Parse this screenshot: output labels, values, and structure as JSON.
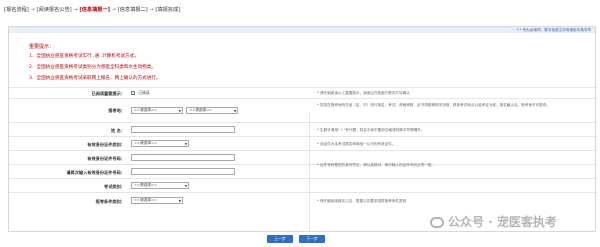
{
  "steps": {
    "s1": "[报名流程]",
    "s2": "[阅读报名公告]",
    "s3": "[信息填报一]",
    "s4": "[信息填报二]",
    "s5": "[填报完成]",
    "arrow": "→"
  },
  "header": {
    "required_tip": "* * 号为必填项，数字及英文字母请用半角字符"
  },
  "notice": {
    "title": "重要提示：",
    "lines": [
      "1．全国执业兽医资格考试实行..通..计算机考试方式。",
      "2．全国执业兽医资格考试类别分为兽医全科类和水生动物类。",
      "3．全国执业兽医资格考试采取网上报名、网上确认的方式进行。"
    ]
  },
  "form": {
    "read_notice": {
      "label": "已阅读重要提示：",
      "option": "已阅读"
    },
    "exam_area": {
      "label": "报考地：",
      "placeholder": "==请选择==",
      "hint": "* 您将在报考地所在省（区、市）进行报名、考试、资格审核、证书领取等相关流程，具体考试地点以准考证为准。报名截止后，报考地不可更改。"
    },
    "name": {
      "label": "姓 名：",
      "hint": "* 生僻字请用\" * \"号代替，姓名中间不要用空格或特殊字符等隔开。"
    },
    "id_type": {
      "label": "有效身份证件类别：",
      "placeholder": "==请选择==",
      "hint": "* 该证件为本考试报名审核唯一认可的有效证件。"
    },
    "id_number": {
      "label": "有效身份证件号码："
    },
    "id_number_confirm": {
      "label": "请再次输入有效身份证件号码：",
      "hint": "* 证件号码是您的身份凭证，请认真核对，两次输入的证件号码必须一致。"
    },
    "exam_category": {
      "label": "考试类别：",
      "placeholder": "==请选择=="
    },
    "exam_condition": {
      "label": "报考条件类别：",
      "placeholder": "==请选择==",
      "hint": "* 请仔细阅读报名公告，根据公告要求选择报考条件类别"
    }
  },
  "buttons": {
    "prev": "上一步",
    "next": "下一步"
  },
  "watermark": {
    "text": "公众号 · 宠医客执考"
  },
  "colors": {
    "accent": "#c00000",
    "button": "#2f6fc6"
  }
}
